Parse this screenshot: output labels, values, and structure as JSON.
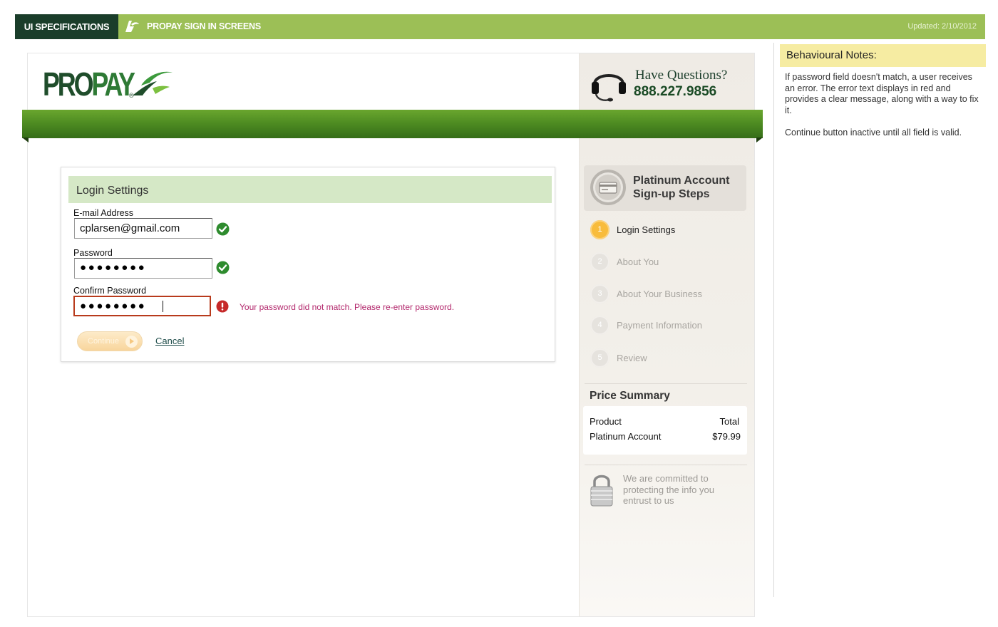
{
  "spec_banner": {
    "tag": "UI SPECIFICATIONS",
    "project": "PROPAY SIGN IN SCREENS",
    "updated": "Updated: 2/10/2012"
  },
  "brand": {
    "pro": "PRO",
    "pay": "PAY",
    "registered": "®"
  },
  "help": {
    "question": "Have Questions?",
    "phone": "888.227.9856"
  },
  "login": {
    "title": "Login Settings",
    "email_label": "E-mail Address",
    "email_value": "cplarsen@gmail.com",
    "password_label": "Password",
    "password_mask": "●●●●●●●●",
    "confirm_label": "Confirm Password",
    "confirm_mask": "●●●●●●●●",
    "error_message": "Your password did not match. Please re-enter password.",
    "continue_label": "Continue",
    "cancel_label": "Cancel"
  },
  "steps": {
    "title": "Platinum Account Sign-up Steps",
    "items": [
      {
        "num": "1",
        "label": "Login Settings",
        "active": true
      },
      {
        "num": "2",
        "label": "About You",
        "active": false
      },
      {
        "num": "3",
        "label": "About Your Business",
        "active": false
      },
      {
        "num": "4",
        "label": "Payment Information",
        "active": false
      },
      {
        "num": "5",
        "label": "Review",
        "active": false
      }
    ]
  },
  "price": {
    "title": "Price Summary",
    "col_product": "Product",
    "col_total": "Total",
    "product": "Platinum Account",
    "total": "$79.99"
  },
  "security": {
    "text": "We are committed to protecting the info you entrust to us"
  },
  "notes": {
    "title": "Behavioural Notes:",
    "paragraph1": "If password field doesn't match, a user receives an error.  The error text displays in red and provides a clear message, along with a way to fix it.",
    "paragraph2": "Continue button inactive until all field is valid."
  },
  "colors": {
    "brand_dark": "#1a3d2a",
    "banner_green": "#9cbf56",
    "band_green": "#4f8d22",
    "error_red": "#b83a1c",
    "error_text": "#b2266b",
    "step_active": "#f8bc3c",
    "success_green": "#2e8b2e",
    "notes_yellow": "#f6eca2"
  },
  "icons": {
    "spec_logo": "propay-mark-icon",
    "headset": "headset-icon",
    "valid": "check-circle-icon",
    "error": "exclamation-circle-icon",
    "continue": "arrow-right-circle-icon",
    "steps_medal": "credit-card-medal-icon",
    "lock": "padlock-icon"
  }
}
